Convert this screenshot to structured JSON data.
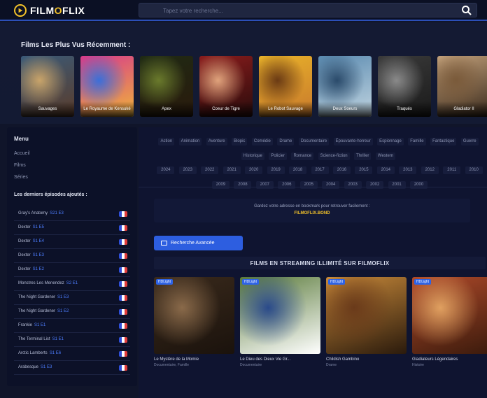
{
  "header": {
    "logo_text_a": "FILM",
    "logo_text_b": "O",
    "logo_text_c": "FLIX",
    "search_placeholder": "Tapez votre recherche..."
  },
  "recent": {
    "title": "Films Les Plus Vus Récemment :",
    "posters": [
      {
        "caption": "Sauvages",
        "colors": [
          "#3a5a78",
          "#c9a46a",
          "#5b3c2a"
        ]
      },
      {
        "caption": "Le Royaume de Kensuké",
        "colors": [
          "#d63a8c",
          "#3b6fd9",
          "#f0b43a"
        ]
      },
      {
        "caption": "Apex",
        "colors": [
          "#1f2a14",
          "#6a7a2c",
          "#2a1a0c"
        ]
      },
      {
        "caption": "Coeur de Tigre",
        "colors": [
          "#8a1c1c",
          "#e0a37c",
          "#2a0c0c"
        ]
      },
      {
        "caption": "Le Robot Sauvage",
        "colors": [
          "#e8b22a",
          "#6a3a14",
          "#c97a2c"
        ]
      },
      {
        "caption": "Deux Soeurs",
        "colors": [
          "#5a8ab0",
          "#2a4a6a",
          "#c0d4e0"
        ]
      },
      {
        "caption": "Traqués",
        "colors": [
          "#3a3a3a",
          "#8a8a8a",
          "#1a1a1a"
        ]
      },
      {
        "caption": "Gladiator II",
        "colors": [
          "#c2a07a",
          "#7a5a3a",
          "#3a2a1c"
        ]
      }
    ]
  },
  "sidebar": {
    "menu_title": "Menu",
    "links": [
      "Accueil",
      "Films",
      "Séries"
    ],
    "list_title": "Les derniers épisodes ajoutés :",
    "series": [
      {
        "name": "Gray's Anatomy",
        "ep": "S21 E3"
      },
      {
        "name": "Dexter",
        "ep": "S1 E5"
      },
      {
        "name": "Dexter",
        "ep": "S1 E4"
      },
      {
        "name": "Dexter",
        "ep": "S1 E3"
      },
      {
        "name": "Dexter",
        "ep": "S1 E2"
      },
      {
        "name": "Monstres Les Menendez",
        "ep": "S2 E1"
      },
      {
        "name": "The Night Gardener",
        "ep": "S1 E3"
      },
      {
        "name": "The Night Gardener",
        "ep": "S1 E2"
      },
      {
        "name": "Frankie",
        "ep": "S1 E1"
      },
      {
        "name": "The Terminal List",
        "ep": "S1 E1"
      },
      {
        "name": "Arctic Lamberts",
        "ep": "S1 E6"
      },
      {
        "name": "Arabesque",
        "ep": "S1 E3"
      }
    ]
  },
  "genres": [
    "Action",
    "Animation",
    "Aventure",
    "Biopic",
    "Comédie",
    "Drame",
    "Documentaire",
    "Épouvante-horreur",
    "Espionnage",
    "Famille",
    "Fantastique",
    "Guerre",
    "Historique",
    "Policier",
    "Romance",
    "Science-fiction",
    "Thriller",
    "Western"
  ],
  "years": [
    "2024",
    "2023",
    "2022",
    "2021",
    "2020",
    "2019",
    "2018",
    "2017",
    "2016",
    "2015",
    "2014",
    "2013",
    "2012",
    "2011",
    "2010",
    "2009",
    "2008",
    "2007",
    "2006",
    "2005",
    "2004",
    "2003",
    "2002",
    "2001",
    "2000"
  ],
  "notice": {
    "text": "Gardez votre adresse en bookmark pour retrouver facilement :",
    "link": "FILMOFLIX.BOND"
  },
  "advanced_search_label": "Recherche Avancée",
  "section_title": "FILMS EN STREAMING ILLIMITÉ SUR FILMOFLIX",
  "movies": [
    {
      "badge": "HDLight",
      "title": "Le Mystère de la Momie",
      "sub": "Documentaire, Famille",
      "colors": [
        "#3a2a1c",
        "#8a6a4a",
        "#1a120c"
      ]
    },
    {
      "badge": "HDLight",
      "title": "Le Dieu des Dieux Vie Gr...",
      "sub": "Documentaire",
      "colors": [
        "#5a7a3a",
        "#2a4a8a",
        "#ffffff"
      ]
    },
    {
      "badge": "HDLight",
      "title": "Childish Gambino",
      "sub": "Drame",
      "colors": [
        "#c98a3a",
        "#6a3a1a",
        "#2a1a0c"
      ]
    },
    {
      "badge": "HDLight",
      "title": "Gladiateurs Légendaires",
      "sub": "Histoire",
      "colors": [
        "#b04a2a",
        "#e0a060",
        "#3a1a0c"
      ]
    }
  ]
}
